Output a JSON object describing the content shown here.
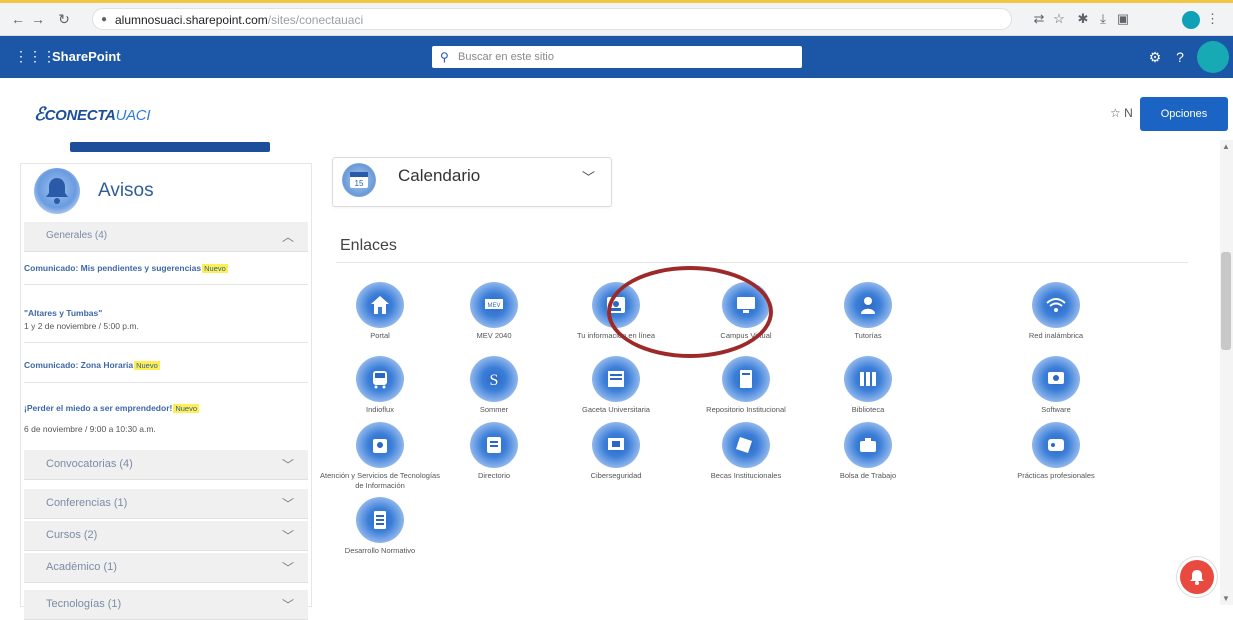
{
  "browser": {
    "url_domain": "alumnosuaci.sharepoint.com",
    "url_path": "/sites/conectauaci"
  },
  "suitebar": {
    "app_title": "SharePoint",
    "search_placeholder": "Buscar en este sitio"
  },
  "site": {
    "logo_prefix": "CONECTA",
    "logo_suffix": "UACI",
    "follow_label": "☆ N",
    "options_button": "Opciones"
  },
  "avisos": {
    "title": "Avisos",
    "groups": [
      {
        "label": "Generales (4)",
        "expanded": true
      },
      {
        "label": "Convocatorias (4)",
        "expanded": false
      },
      {
        "label": "Conferencias (1)",
        "expanded": false
      },
      {
        "label": "Cursos (2)",
        "expanded": false
      },
      {
        "label": "Académico (1)",
        "expanded": false
      },
      {
        "label": "Tecnologías (1)",
        "expanded": false
      }
    ],
    "notices": [
      {
        "title": "Comunicado: Mis pendientes y sugerencias",
        "badge": "Nuevo",
        "subtitle": ""
      },
      {
        "title": "\"Altares y Tumbas\"",
        "badge": "",
        "subtitle": "1 y 2 de noviembre / 5:00 p.m."
      },
      {
        "title": "Comunicado: Zona Horaria",
        "badge": "Nuevo",
        "subtitle": ""
      },
      {
        "title": "¡Perder el miedo a ser emprendedor!",
        "badge": "Nuevo",
        "subtitle": "6 de noviembre / 9:00 a 10:30 a.m."
      }
    ]
  },
  "calendar": {
    "title": "Calendario",
    "day": "15"
  },
  "enlaces": {
    "heading": "Enlaces",
    "links": [
      {
        "label": "Portal",
        "icon": "home-icon"
      },
      {
        "label": "MEV 2040",
        "icon": "mev-icon"
      },
      {
        "label": "Tu información en línea",
        "icon": "profile-card-icon"
      },
      {
        "label": "Campus Virtual",
        "icon": "monitor-icon"
      },
      {
        "label": "Tutorías",
        "icon": "tutor-icon"
      },
      {
        "label": "Red inalámbrica",
        "icon": "wifi-icon"
      },
      {
        "label": "Indioflux",
        "icon": "bus-icon"
      },
      {
        "label": "Sommer",
        "icon": "sommer-icon"
      },
      {
        "label": "Gaceta Universitaria",
        "icon": "newspaper-icon"
      },
      {
        "label": "Repositorio Institucional",
        "icon": "repository-icon"
      },
      {
        "label": "Biblioteca",
        "icon": "library-icon"
      },
      {
        "label": "Software",
        "icon": "software-icon"
      },
      {
        "label": "Atención y Servicios de Tecnologías de Información",
        "icon": "it-service-icon"
      },
      {
        "label": "Directorio",
        "icon": "directory-icon"
      },
      {
        "label": "Ciberseguridad",
        "icon": "cyber-icon"
      },
      {
        "label": "Becas Institucionales",
        "icon": "scholarship-icon"
      },
      {
        "label": "Bolsa de Trabajo",
        "icon": "briefcase-icon"
      },
      {
        "label": "Prácticas profesionales",
        "icon": "practice-icon"
      },
      {
        "label": "Desarrollo Normativo",
        "icon": "document-list-icon"
      }
    ]
  },
  "colors": {
    "suitebar": "#1c56a6",
    "accent": "#1c64c4",
    "highlight_ring": "#9c2a2a",
    "new_badge": "#ffef55"
  }
}
